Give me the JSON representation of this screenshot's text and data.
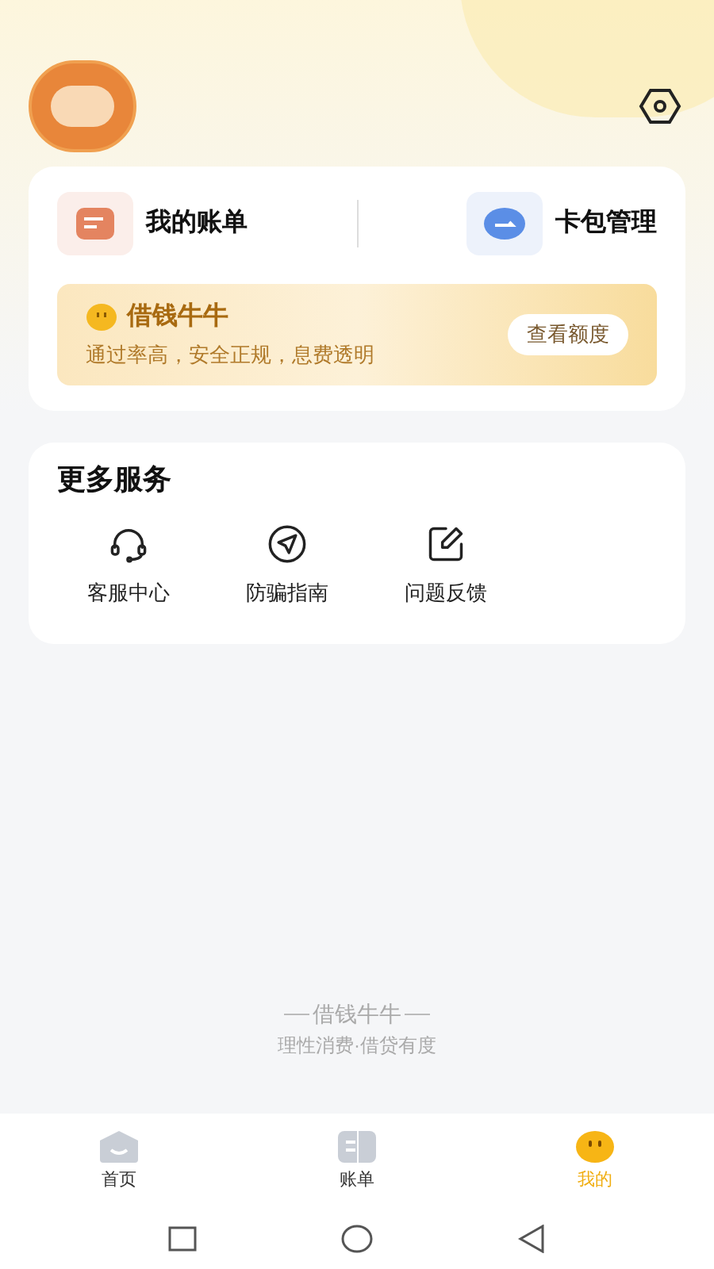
{
  "shortcuts": [
    {
      "kind": "bill",
      "label": "我的账单"
    },
    {
      "kind": "card",
      "label": "卡包管理"
    }
  ],
  "promo": {
    "title": "借钱牛牛",
    "subtitle": "通过率高，安全正规，息费透明",
    "button": "查看额度"
  },
  "services": {
    "title": "更多服务",
    "items": [
      {
        "kind": "headset",
        "label": "客服中心"
      },
      {
        "kind": "send",
        "label": "防骗指南"
      },
      {
        "kind": "edit",
        "label": "问题反馈"
      }
    ]
  },
  "footer": {
    "brand": "借钱牛牛",
    "slogan": "理性消费·借贷有度"
  },
  "tabs": [
    {
      "kind": "home",
      "label": "首页",
      "selected": false
    },
    {
      "kind": "bill",
      "label": "账单",
      "selected": false
    },
    {
      "kind": "me",
      "label": "我的",
      "selected": true
    }
  ]
}
